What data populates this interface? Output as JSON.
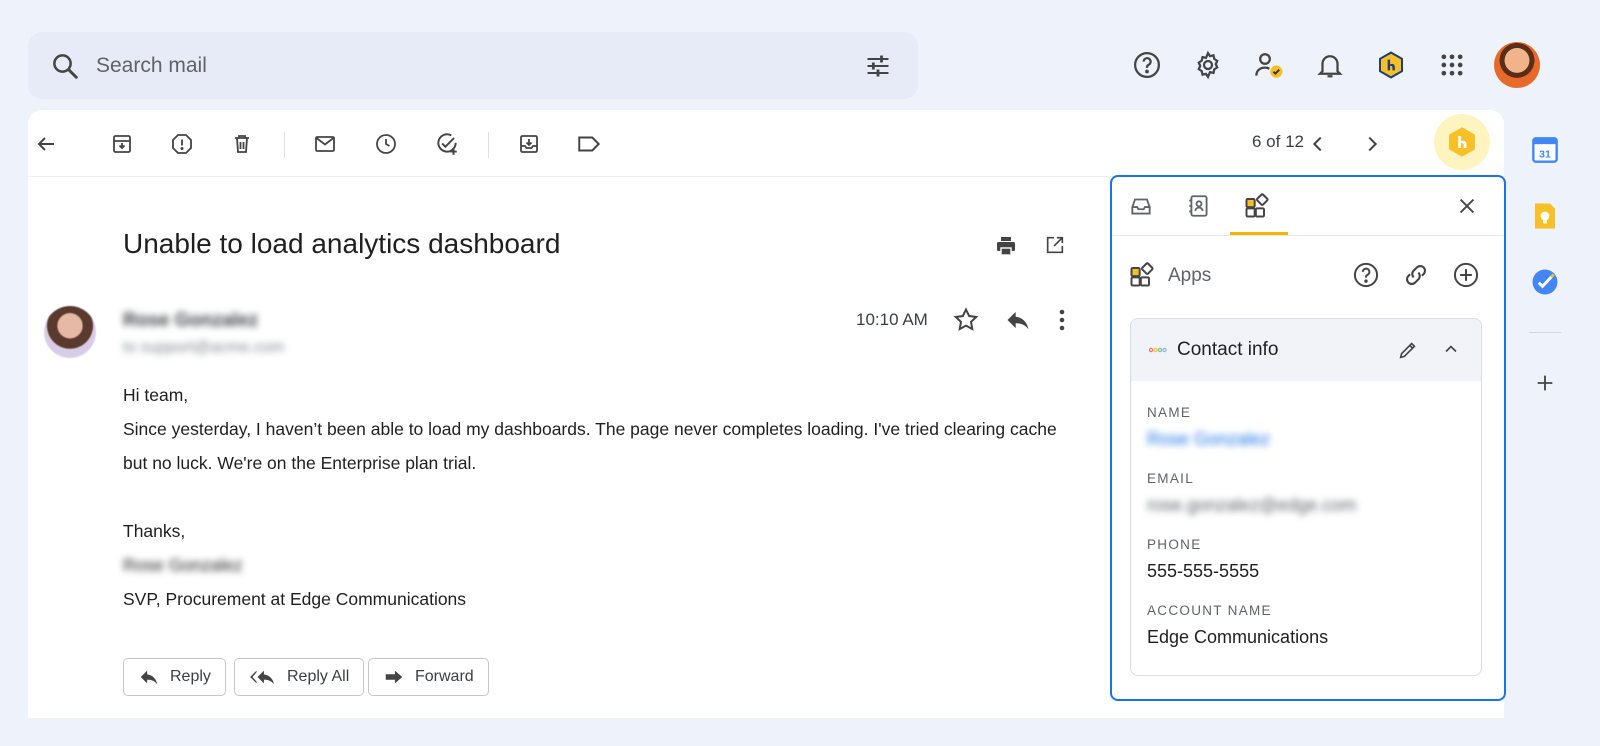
{
  "search": {
    "placeholder": "Search mail"
  },
  "toolbar": {
    "pager": "6 of 12"
  },
  "email": {
    "subject": "Unable to load analytics dashboard",
    "sender_name": "Rose Gonzalez",
    "sender_to": "to support@acme.com",
    "time": "10:10 AM",
    "body": [
      "Hi team,",
      "Since yesterday, I haven’t been able to load my dashboards. The page never completes loading. I've tried clearing cache",
      "but no luck. We're on the Enterprise plan trial.",
      "",
      "Thanks,",
      "Rose Gonzalez",
      "SVP, Procurement at Edge Communications"
    ],
    "actions": {
      "reply": "Reply",
      "reply_all": "Reply All",
      "forward": "Forward"
    }
  },
  "panel": {
    "apps_title": "Apps",
    "card_title": "Contact info",
    "fields": {
      "name_label": "NAME",
      "name_value": "Rose Gonzalez",
      "email_label": "EMAIL",
      "email_value": "rose.gonzalez@edge.com",
      "phone_label": "PHONE",
      "phone_value": "555-555-5555",
      "account_label": "ACCOUNT NAME",
      "account_value": "Edge Communications"
    }
  },
  "rail": {
    "calendar_day": "31"
  },
  "colors": {
    "accent_blue": "#1a73e8",
    "tab_underline": "#f4b400",
    "page_bg": "#eef2fb"
  },
  "icons": [
    "search-icon",
    "tune-icon",
    "help-icon",
    "settings-icon",
    "status-icon",
    "bell-icon",
    "extension-icon",
    "apps-grid-icon",
    "back-icon",
    "archive-icon",
    "spam-icon",
    "delete-icon",
    "mark-unread-icon",
    "snooze-icon",
    "add-task-icon",
    "move-to-icon",
    "label-icon",
    "prev-icon",
    "next-icon",
    "print-icon",
    "open-new-window-icon",
    "star-icon",
    "reply-icon",
    "more-vert-icon",
    "inbox-tab-icon",
    "contacts-tab-icon",
    "apps-tab-icon",
    "close-icon",
    "link-icon",
    "add-circle-icon",
    "edit-icon",
    "chevron-up-icon",
    "calendar-icon",
    "keep-icon",
    "tasks-icon",
    "add-icon"
  ]
}
